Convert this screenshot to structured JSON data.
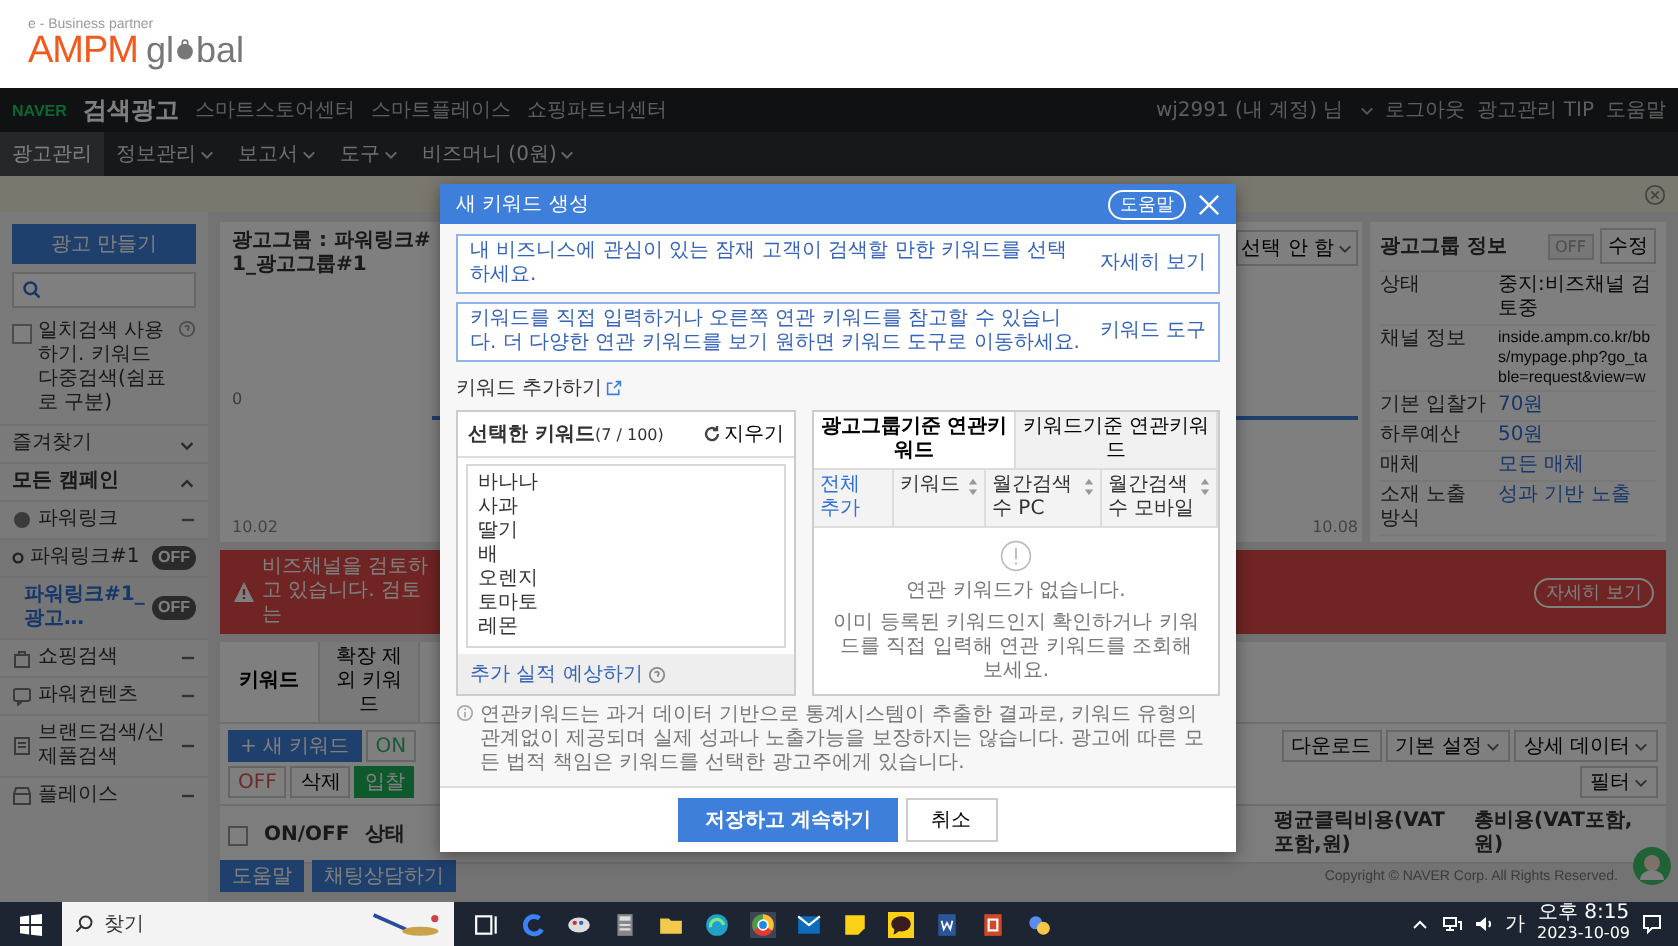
{
  "logo": {
    "tagline": "e - Business partner",
    "word": "AMPM",
    "word2_start": "gl",
    "word2_end": "bal"
  },
  "top_bar": {
    "brand": "NAVER",
    "title": "검색광고",
    "links": [
      "스마트스토어센터",
      "스마트플레이스",
      "쇼핑파트너센터"
    ],
    "account": "wj2991 (내 계정) 님",
    "account_links": [
      "로그아웃",
      "광고관리 TIP",
      "도움말"
    ]
  },
  "menu": [
    {
      "label": "광고관리",
      "selected": true,
      "dropdown": false
    },
    {
      "label": "정보관리",
      "selected": false,
      "dropdown": true
    },
    {
      "label": "보고서",
      "selected": false,
      "dropdown": true
    },
    {
      "label": "도구",
      "selected": false,
      "dropdown": true
    },
    {
      "label": "비즈머니 (0원)",
      "selected": false,
      "dropdown": true
    }
  ],
  "sidebar": {
    "create_button": "광고 만들기",
    "exact_match": {
      "label": "일치검색 사용 하기. 키워드 다중검색(쉼표로 구분)",
      "checked": false
    },
    "sections": [
      {
        "label": "즐겨찾기",
        "expanded": false
      },
      {
        "label": "모든 캠페인",
        "expanded": true
      }
    ],
    "campaigns": [
      {
        "label": "파워링크",
        "kind": "powerlink",
        "children": [
          {
            "label": "파워링크#1",
            "badge": "OFF",
            "selected": false,
            "children": [
              {
                "label": "파워링크#1_광고…",
                "badge": "OFF",
                "selected": true
              }
            ]
          }
        ]
      },
      {
        "label": "쇼핑검색",
        "kind": "shopping"
      },
      {
        "label": "파워컨텐츠",
        "kind": "content"
      },
      {
        "label": "브랜드검색/신제품검색",
        "kind": "brand"
      },
      {
        "label": "플레이스",
        "kind": "place"
      }
    ]
  },
  "main": {
    "ad_group_title": "광고그룹 : 파워링크#1_광고그룹#1",
    "chart_select": "선택 안 함",
    "chart": {
      "y_label": "0",
      "x_labels": [
        "10.02",
        "10.08"
      ]
    },
    "ad_group_info": {
      "title": "광고그룹 정보",
      "toggle": {
        "label": "OFF",
        "on": false
      },
      "edit_button": "수정",
      "rows": [
        {
          "label": "상태",
          "value": "중지:비즈채널 검토중",
          "link": false
        },
        {
          "label": "채널 정보",
          "value": "inside.ampm.co.kr/bbs/mypage.php?go_table=request&view=w",
          "link": false
        },
        {
          "label": "기본 입찰가",
          "value": "70원",
          "link": true
        },
        {
          "label": "하루예산",
          "value": "50원",
          "link": true
        },
        {
          "label": "매체",
          "value": "모든 매체",
          "link": true
        },
        {
          "label": "소재 노출 방식",
          "value": "성과 기반 노출",
          "link": true
        }
      ]
    },
    "alert": {
      "message": "비즈채널을 검토하고 있습니다. 검토는",
      "button": "자세히 보기"
    },
    "tabs": [
      {
        "label": "키워드",
        "selected": true
      },
      {
        "label": "확장 제외 키워드",
        "selected": false
      }
    ],
    "toolbar": {
      "new_button": "+ 새 키워드",
      "actions": [
        {
          "label": "ON",
          "kind": "on"
        },
        {
          "label": "OFF",
          "kind": "off"
        },
        {
          "label": "삭제",
          "kind": "plain"
        },
        {
          "label": "입찰",
          "kind": "green"
        }
      ],
      "right": [
        {
          "label": "다운로드",
          "dropdown": false
        },
        {
          "label": "기본 설정",
          "dropdown": true
        },
        {
          "label": "상세 데이터",
          "dropdown": true
        },
        {
          "label": "필터",
          "dropdown": true
        }
      ]
    },
    "table": {
      "select_all": {
        "checked": false
      },
      "columns": [
        "ON/OFF",
        "상태",
        "평균클릭비용(VAT포함,원)",
        "총비용(VAT포함,원)"
      ]
    },
    "footer": {
      "buttons": [
        "도움말",
        "채팅상담하기"
      ],
      "copyright": "Copyright © NAVER Corp. All Rights Reserved."
    }
  },
  "modal": {
    "title": "새 키워드 생성",
    "help": "도움말",
    "notices": [
      {
        "text": "내 비즈니스에 관심이 있는 잠재 고객이 검색할 만한 키워드를 선택하세요.",
        "link": "자세히 보기"
      },
      {
        "text": "키워드를 직접 입력하거나 오른쪽 연관 키워드를 참고할 수 있습니다. 더 다양한 연관 키워드를 보기 원하면 키워드 도구로 이동하세요.",
        "link": "키워드 도구"
      }
    ],
    "add_label": "키워드 추가하기",
    "selected": {
      "title": "선택한 키워드",
      "count": "(7 / 100)",
      "clear": "지우기",
      "value": "바나나\n사과\n딸기\n배\n오렌지\n토마토\n레몬",
      "forecast": "추가 실적 예상하기"
    },
    "note": "연관키워드는 과거 데이터 기반으로 통계시스템이 추출한 결과로, 키워드 유형의 관계없이 제공되며 실제 성과나 노출가능을 보장하지는 않습니다. 광고에 따른 모든 법적 책임은 키워드를 선택한 광고주에게 있습니다.",
    "related": {
      "tabs": [
        {
          "label": "광고그룹기준 연관키워드",
          "selected": true
        },
        {
          "label": "키워드기준 연관키워드",
          "selected": false
        }
      ],
      "columns": [
        {
          "label": "전체 추가",
          "kind": "link"
        },
        {
          "label": "키워드",
          "kind": "sort"
        },
        {
          "label": "월간검색수 PC",
          "kind": "sort"
        },
        {
          "label": "월간검색수 모바일",
          "kind": "sort"
        }
      ],
      "empty_title": "연관 키워드가 없습니다.",
      "empty_text": "이미 등록된 키워드인지 확인하거나 키워드를 직접 입력해 연관 키워드를 조회해 보세요."
    },
    "buttons": [
      {
        "label": "저장하고 계속하기",
        "primary": true
      },
      {
        "label": "취소",
        "primary": false
      }
    ]
  },
  "taskbar": {
    "search_placeholder": "찾기",
    "ime": "가",
    "time": "오후 8:15",
    "date": "2023-10-09"
  }
}
